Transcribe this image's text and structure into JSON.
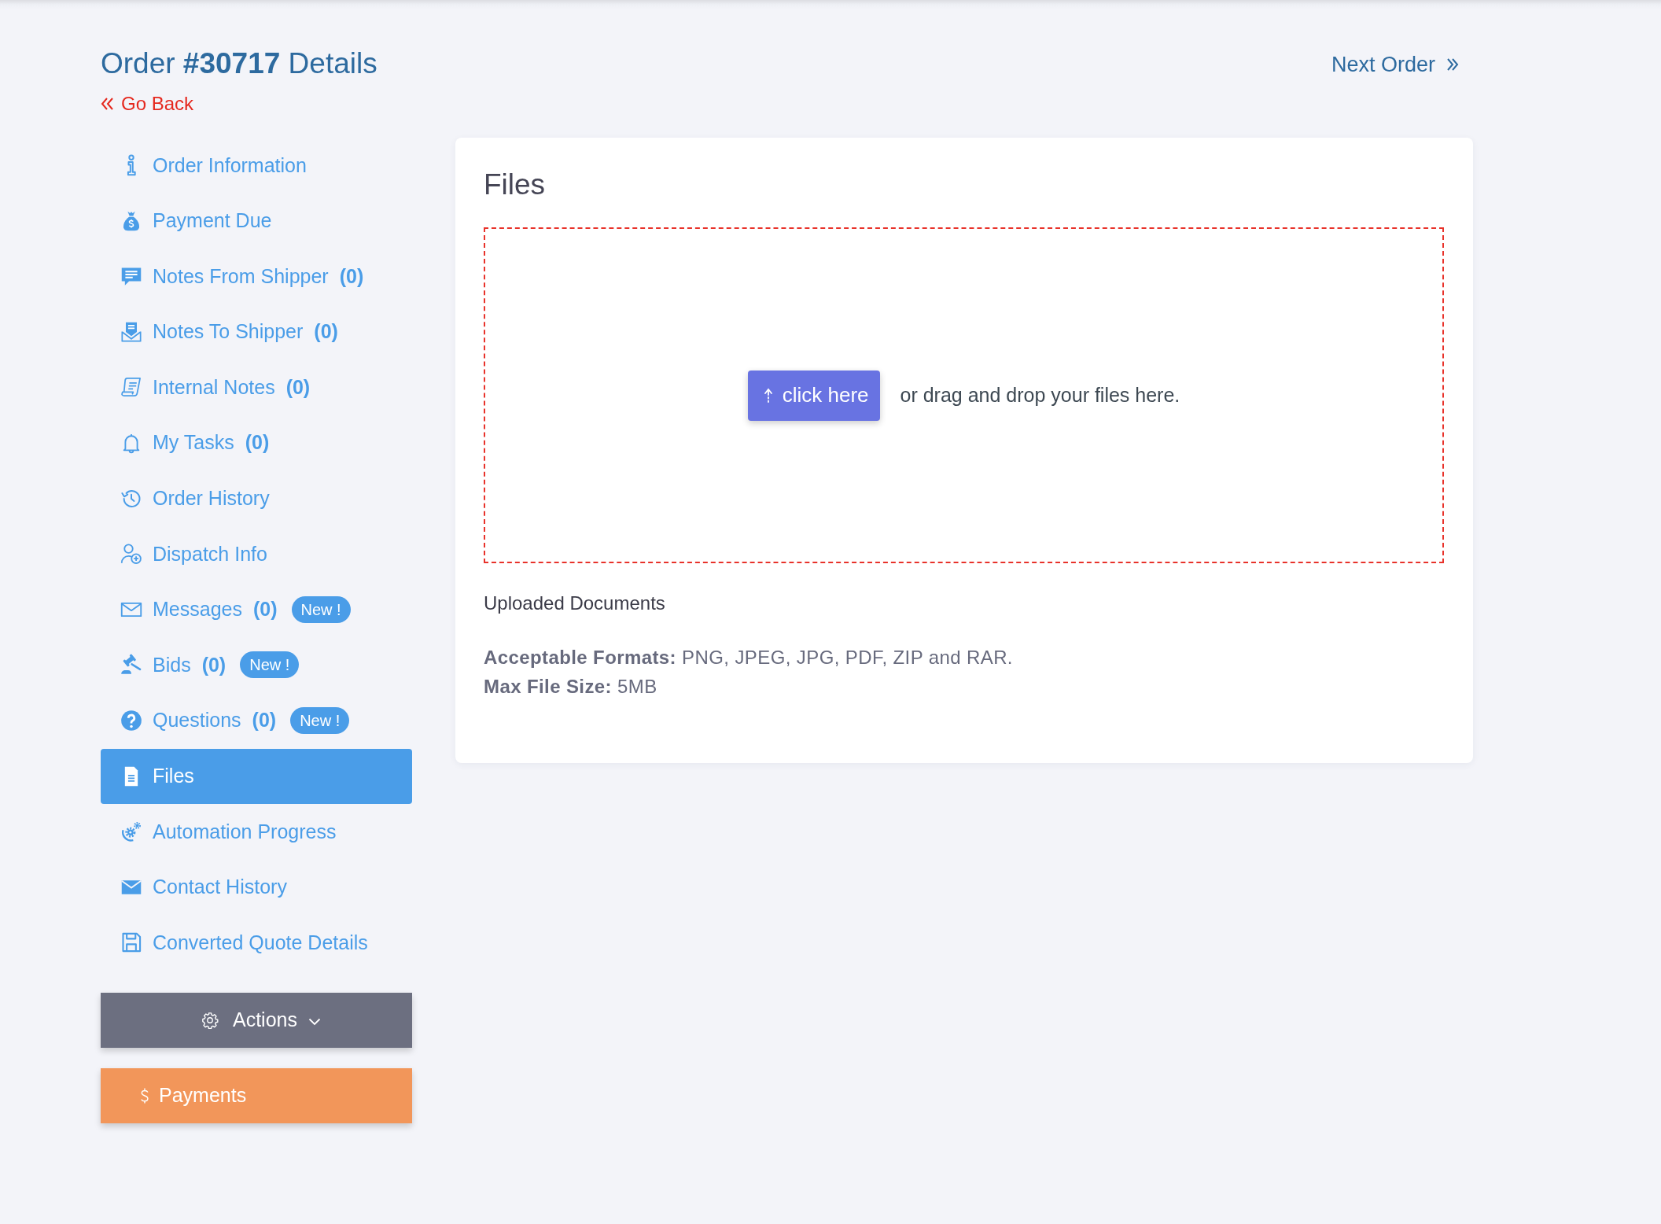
{
  "header": {
    "title": "Order **#30717** Details",
    "back_link": "Go Back",
    "next_link": "Next Order"
  },
  "sidebar": {
    "items": [
      {
        "label": "Order Information",
        "selected": false
      },
      {
        "label": "Payment Due",
        "selected": false
      },
      {
        "label": "Notes From Shipper",
        "count": "(0)",
        "selected": false
      },
      {
        "label": "Notes To Shipper",
        "count": "(0)",
        "selected": false
      },
      {
        "label": "Internal Notes",
        "count": "(0)",
        "selected": false
      },
      {
        "label": "My Tasks",
        "count": "(0)",
        "selected": false
      },
      {
        "label": "Order History",
        "selected": false
      },
      {
        "label": "Dispatch Info",
        "selected": false
      },
      {
        "label": "Messages",
        "count": "(0)",
        "badge": "New !",
        "selected": false
      },
      {
        "label": "Bids",
        "count": "(0)",
        "badge": "New !",
        "selected": false
      },
      {
        "label": "Questions",
        "count": "(0)",
        "badge": "New !",
        "selected": false
      },
      {
        "label": "Files",
        "selected": true
      },
      {
        "label": "Automation Progress",
        "selected": false
      },
      {
        "label": "Contact History",
        "selected": false
      },
      {
        "label": "Converted Quote Details",
        "selected": false
      }
    ],
    "buttons": [
      {
        "kind": "actions",
        "label": "Actions"
      },
      {
        "kind": "payments",
        "label": "Payments"
      }
    ]
  },
  "panel": {
    "title": "Files",
    "dropzone": {
      "button": "click here",
      "hint": "or drag and drop your files here."
    },
    "uploaded_heading": "Uploaded Documents",
    "notes": [
      "**Acceptable Formats:** PNG, JPEG, JPG, PDF, ZIP and RAR.",
      "**Max File Size:** 5MB"
    ]
  }
}
